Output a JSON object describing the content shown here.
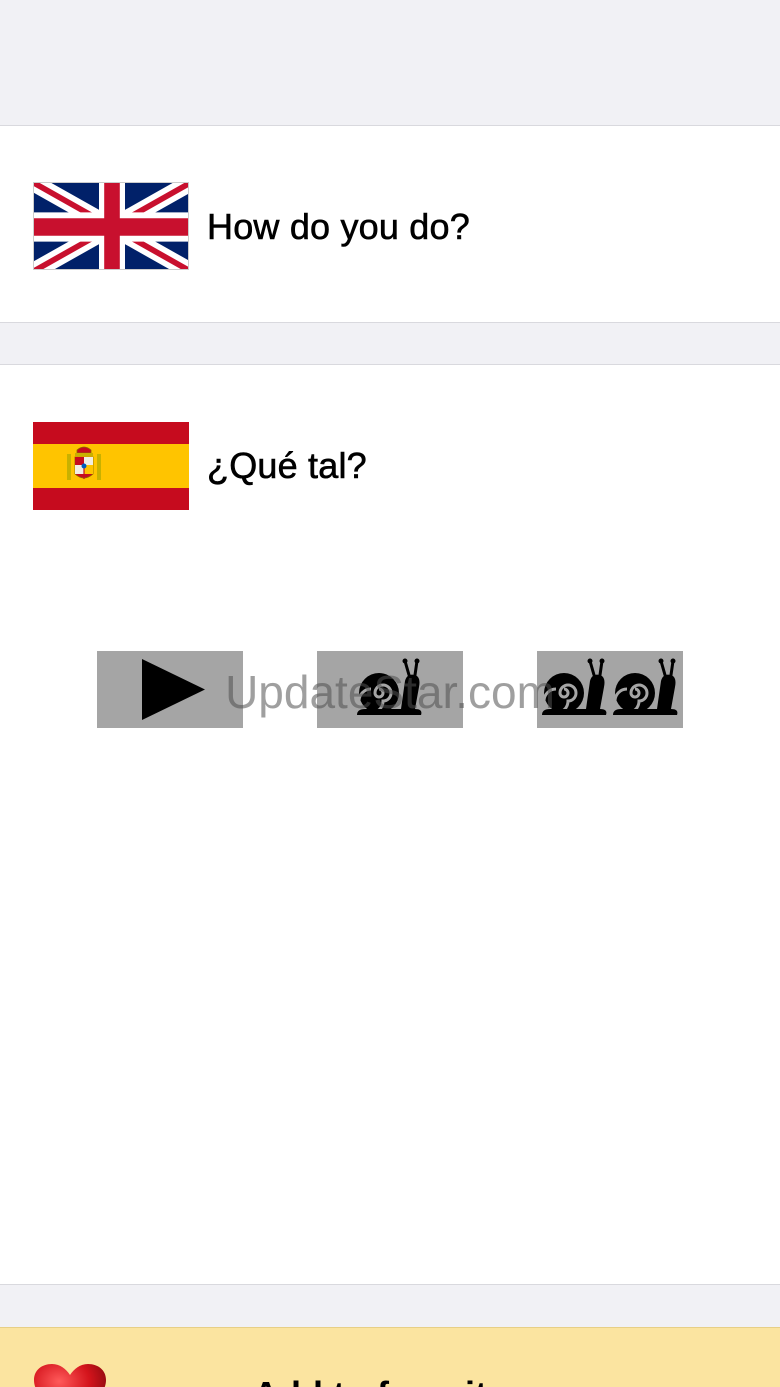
{
  "phrases": {
    "english": {
      "flag_icon": "uk-flag-icon",
      "text": "How do you do?"
    },
    "spanish": {
      "flag_icon": "spain-flag-icon",
      "text": "¿Qué tal?"
    }
  },
  "playback": {
    "play_icon": "play-icon",
    "slow_icon": "snail-icon",
    "slower_icon": "double-snail-icon",
    "button_color": "#a5a5a5"
  },
  "watermark": {
    "text": "UpdateStar.com"
  },
  "favorites": {
    "icon": "heart-icon",
    "label": "Add to favorites",
    "background": "#fbe4a0"
  }
}
